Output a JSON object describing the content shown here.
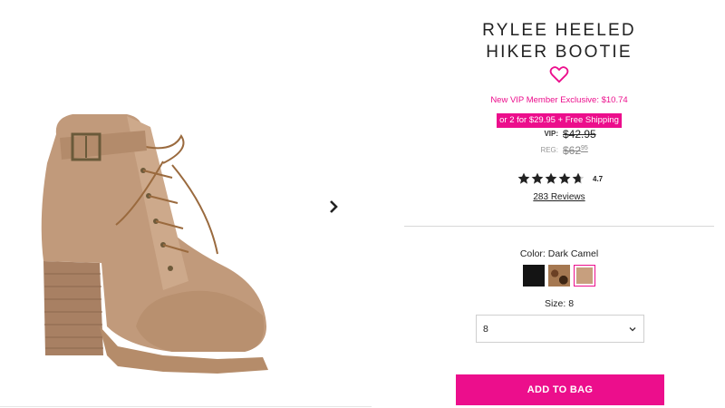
{
  "product": {
    "title_line1": "RYLEE HEELED",
    "title_line2": "HIKER BOOTIE",
    "vip_exclusive": "New VIP Member Exclusive: $10.74",
    "promo": "or 2 for $29.95 + Free Shipping",
    "vip_label": "VIP:",
    "vip_price": "$42.95",
    "reg_label": "REG:",
    "reg_price_main": "$62",
    "reg_price_cents": "95",
    "rating": "4.7",
    "rating_value": 4.7,
    "reviews": "283 Reviews"
  },
  "color": {
    "label": "Color: Dark Camel",
    "swatches": [
      "black",
      "leopard",
      "dark-camel"
    ],
    "selected": "dark-camel"
  },
  "size": {
    "label": "Size: 8",
    "selected": "8"
  },
  "cta": {
    "add_to_bag": "ADD TO BAG"
  },
  "icons": {
    "next": "chevron-right-icon",
    "favorite": "heart-outline-icon",
    "dropdown": "chevron-down-icon",
    "star": "star-icon"
  },
  "colors": {
    "accent": "#ec0e8c",
    "text": "#222222",
    "divider": "#d8d8d8"
  }
}
